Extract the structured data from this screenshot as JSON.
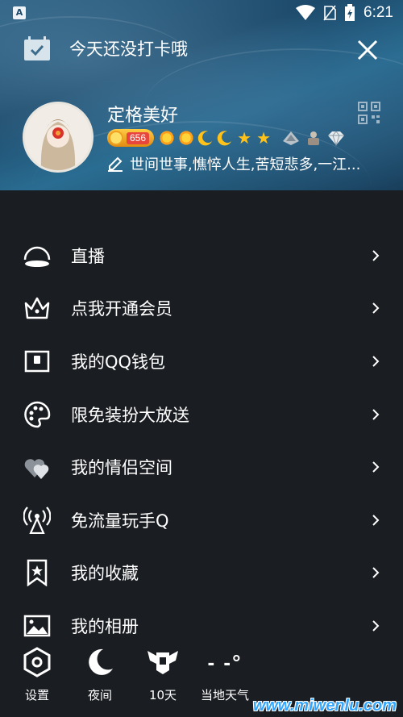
{
  "statusbar": {
    "time": "6:21",
    "left_badge": "A"
  },
  "checkin": {
    "text": "今天还没打卡哦"
  },
  "profile": {
    "nickname": "定格美好",
    "level": "656",
    "signature": "世间世事,憔悴人生,苦短悲多,一江..."
  },
  "menu": {
    "items": [
      {
        "label": "直播",
        "icon": "live-icon"
      },
      {
        "label": "点我开通会员",
        "icon": "crown-icon"
      },
      {
        "label": "我的QQ钱包",
        "icon": "wallet-icon"
      },
      {
        "label": "限免装扮大放送",
        "icon": "palette-icon"
      },
      {
        "label": "我的情侣空间",
        "icon": "hearts-icon"
      },
      {
        "label": "免流量玩手Q",
        "icon": "antenna-icon"
      },
      {
        "label": "我的收藏",
        "icon": "bookmark-star-icon"
      },
      {
        "label": "我的相册",
        "icon": "photo-icon"
      }
    ]
  },
  "bottom": {
    "settings": "设置",
    "night": "夜间",
    "days": "10天",
    "weather_label": "当地天气",
    "weather_value": "- -°"
  },
  "watermark": "www.miwenlu.com",
  "colors": {
    "background": "#1a1d22",
    "header_blue": "#1d4a6b",
    "watermark": "#33a6ff"
  }
}
